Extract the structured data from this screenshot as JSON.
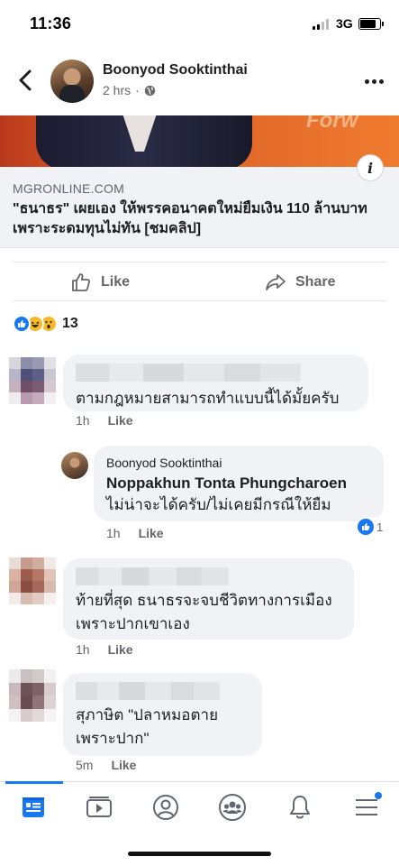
{
  "status_bar": {
    "time": "11:36",
    "network": "3G",
    "battery_level": 0.85,
    "signal_bars": 2
  },
  "post": {
    "author": "Boonyod Sooktinthai",
    "time_ago": "2 hrs",
    "separator": "·",
    "audience_icon": "globe-icon"
  },
  "link": {
    "image_sign_text": "Forw",
    "info_icon": "i",
    "domain": "MGRONLINE.COM",
    "title": "\"ธนาธร\" เผยเอง ให้พรรคอนาคตใหม่ยืมเงิน 110 ล้านบาท เพราะระดมทุนไม่ทัน [ชมคลิป]"
  },
  "actions": {
    "like_label": "Like",
    "share_label": "Share"
  },
  "reactions": {
    "types": [
      "like",
      "haha",
      "wow"
    ],
    "count": "13"
  },
  "comments": [
    {
      "text": "ตามกฎหมายสามารถทำแบบนี้ได้มั้ยครับ",
      "time": "1h",
      "like_label": "Like",
      "reply": {
        "author": "Boonyod Sooktinthai",
        "tag": "Noppakhun Tonta Phungcharoen",
        "text": "ไม่น่าจะได้ครับ/ไม่เคยมีกรณีให้ยืม",
        "time": "1h",
        "like_label": "Like",
        "like_count": "1"
      }
    },
    {
      "text": "ท้ายที่สุด ธนาธรจะจบชีวิตทางการเมืองเพราะปากเขาเอง",
      "time": "1h",
      "like_label": "Like"
    },
    {
      "text": "สุภาษิต \"ปลาหมอตายเพราะปาก\"",
      "time": "5m",
      "like_label": "Like"
    }
  ],
  "tab_bar": {
    "items": [
      "news-feed-icon",
      "watch-icon",
      "profile-icon",
      "groups-icon",
      "notifications-icon",
      "menu-icon"
    ],
    "active": "news-feed-icon",
    "menu_has_badge": true
  },
  "colors": {
    "accent": "#1877f2",
    "bubble": "#f0f2f5",
    "secondary_text": "#65676b"
  }
}
